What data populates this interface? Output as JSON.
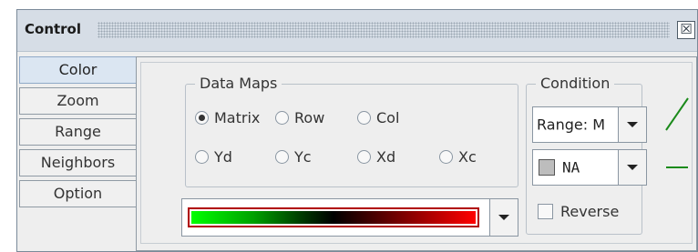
{
  "window": {
    "title": "Control",
    "close_glyph": "☒"
  },
  "tabs": [
    {
      "label": "Color",
      "selected": true
    },
    {
      "label": "Zoom",
      "selected": false
    },
    {
      "label": "Range",
      "selected": false
    },
    {
      "label": "Neighbors",
      "selected": false
    },
    {
      "label": "Option",
      "selected": false
    }
  ],
  "data_maps": {
    "title": "Data Maps",
    "options": [
      {
        "label": "Matrix",
        "checked": true
      },
      {
        "label": "Row",
        "checked": false
      },
      {
        "label": "Col",
        "checked": false
      },
      {
        "label": "Yd",
        "checked": false
      },
      {
        "label": "Yc",
        "checked": false
      },
      {
        "label": "Xd",
        "checked": false
      },
      {
        "label": "Xc",
        "checked": false
      }
    ]
  },
  "colormap": {
    "gradient_stops": [
      "#00ff00",
      "#000000",
      "#ff0000"
    ]
  },
  "condition": {
    "title": "Condition",
    "range_value": "Range: M",
    "na_value": "NA",
    "na_swatch_color": "#bdbdbd",
    "reverse_label": "Reverse",
    "reverse_checked": false
  },
  "colors": {
    "selected_tab": "#dbe6f2",
    "connector_line": "#1a8a1a",
    "titlebar": "#d6dde6"
  }
}
